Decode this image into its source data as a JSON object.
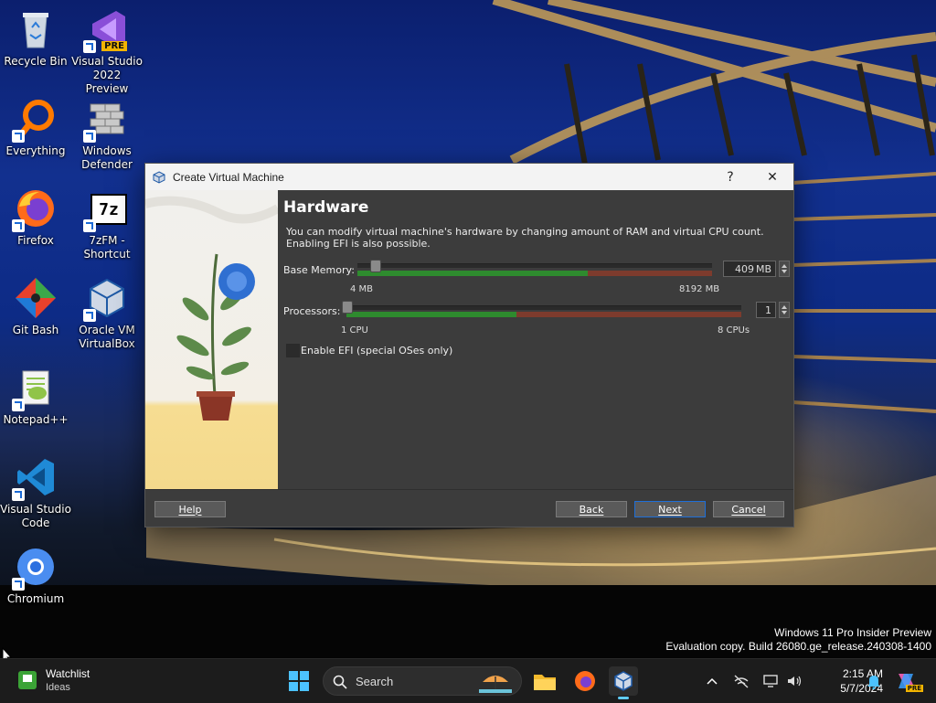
{
  "desktop": {
    "icons": [
      {
        "label": "Recycle Bin"
      },
      {
        "label": "Visual Studio\n2022 Preview",
        "badge": "PRE"
      },
      {
        "label": "Everything"
      },
      {
        "label": "Windows\nDefender"
      },
      {
        "label": "Firefox"
      },
      {
        "label": "7zFM -\nShortcut",
        "glyph": "7z"
      },
      {
        "label": "Git Bash"
      },
      {
        "label": "Oracle VM\nVirtualBox"
      },
      {
        "label": "Notepad++"
      },
      {
        "label": "Visual Studio\nCode"
      },
      {
        "label": "Chromium"
      }
    ]
  },
  "dialog": {
    "title": "Create Virtual Machine",
    "help_glyph": "?",
    "close_glyph": "✕",
    "heading": "Hardware",
    "description": "You can modify virtual machine's hardware by changing amount of RAM and virtual CPU count. Enabling EFI is also possible.",
    "memory": {
      "label": "Base Memory:",
      "value": "409",
      "unit": "MB",
      "min_label": "4 MB",
      "max_label": "8192 MB",
      "min": 4,
      "max": 8192,
      "current": 409
    },
    "processors": {
      "label": "Processors:",
      "value": "1",
      "min_label": "1 CPU",
      "max_label": "8 CPUs",
      "min": 1,
      "max": 8,
      "current": 1
    },
    "efi_label": "Enable EFI (special OSes only)",
    "buttons": {
      "help": "Help",
      "back": "Back",
      "next": "Next",
      "cancel": "Cancel"
    }
  },
  "watermark": {
    "line1": "Windows 11 Pro Insider Preview",
    "line2": "Evaluation copy. Build 26080.ge_release.240308-1400"
  },
  "taskbar": {
    "widget_title": "Watchlist",
    "widget_subtitle": "Ideas",
    "search_placeholder": "Search",
    "time": "2:15 AM",
    "date": "5/7/2024",
    "copilot_badge": "PRE"
  },
  "colors": {
    "green": "#2e8b2e",
    "red": "#8c3a2c",
    "accent": "#1e6fd9"
  }
}
